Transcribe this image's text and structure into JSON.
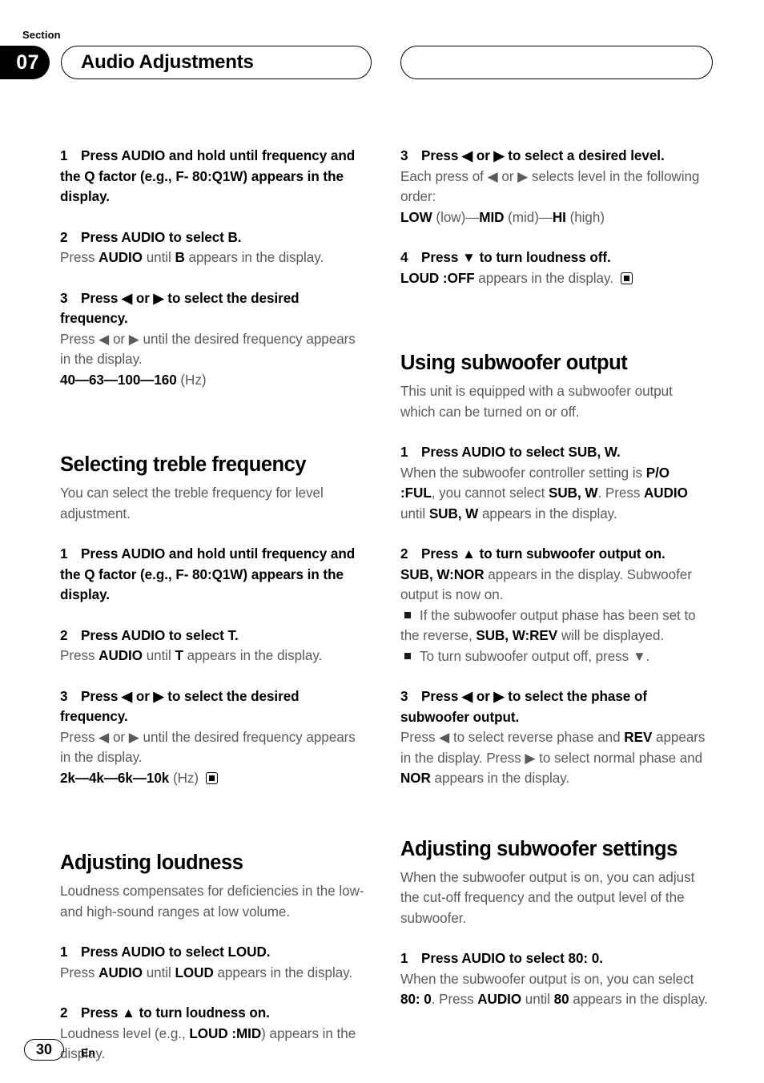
{
  "header": {
    "section_label": "Section",
    "section_number": "07",
    "title": "Audio Adjustments",
    "right_pill_title": ""
  },
  "footer": {
    "page_number": "30",
    "language": "En"
  },
  "left_column": {
    "bass_steps": [
      {
        "num": "1",
        "title_parts": [
          {
            "text": "Press AUDIO and hold until frequency and the Q factor (e.g., F- 80:Q1W) appears in the display.",
            "bold": true
          }
        ]
      },
      {
        "num": "2",
        "title_parts": [
          {
            "text": "Press AUDIO to select B.",
            "bold": true
          }
        ],
        "body_parts": [
          {
            "text": "Press ",
            "bold": false
          },
          {
            "text": "AUDIO",
            "bold": true
          },
          {
            "text": " until ",
            "bold": false
          },
          {
            "text": "B",
            "bold": true
          },
          {
            "text": " appears in the display.",
            "bold": false
          }
        ]
      },
      {
        "num": "3",
        "title_parts": [
          {
            "text": "Press ◀ or ▶ to select the desired frequency.",
            "bold": true
          }
        ],
        "body_parts": [
          {
            "text": "Press ◀ or ▶ until the desired frequency appears in the display.",
            "bold": false
          }
        ],
        "values_parts": [
          {
            "text": "40—63—100—160",
            "bold": true
          },
          {
            "text": " (Hz)",
            "bold": false
          }
        ]
      }
    ],
    "treble_heading": "Selecting treble frequency",
    "treble_lead": "You can select the treble frequency for level adjustment.",
    "treble_steps": [
      {
        "num": "1",
        "title_parts": [
          {
            "text": "Press AUDIO and hold until frequency and the Q factor (e.g., F- 80:Q1W) appears in the display.",
            "bold": true
          }
        ]
      },
      {
        "num": "2",
        "title_parts": [
          {
            "text": "Press AUDIO to select T.",
            "bold": true
          }
        ],
        "body_parts": [
          {
            "text": "Press ",
            "bold": false
          },
          {
            "text": "AUDIO",
            "bold": true
          },
          {
            "text": " until ",
            "bold": false
          },
          {
            "text": "T",
            "bold": true
          },
          {
            "text": " appears in the display.",
            "bold": false
          }
        ]
      },
      {
        "num": "3",
        "title_parts": [
          {
            "text": "Press ◀ or ▶ to select the desired frequency.",
            "bold": true
          }
        ],
        "body_parts": [
          {
            "text": "Press ◀ or ▶ until the desired frequency appears in the display.",
            "bold": false
          }
        ],
        "values_parts": [
          {
            "text": "2k—4k—6k—10k",
            "bold": true
          },
          {
            "text": " (Hz) ",
            "bold": false
          },
          {
            "text": "",
            "eos": true
          }
        ]
      }
    ],
    "loudness_heading": "Adjusting loudness",
    "loudness_lead": "Loudness compensates for deficiencies in the low- and high-sound ranges at low volume.",
    "loudness_steps": [
      {
        "num": "1",
        "title_parts": [
          {
            "text": "Press AUDIO to select LOUD.",
            "bold": true
          }
        ],
        "body_parts": [
          {
            "text": "Press ",
            "bold": false
          },
          {
            "text": "AUDIO",
            "bold": true
          },
          {
            "text": " until ",
            "bold": false
          },
          {
            "text": "LOUD",
            "bold": true
          },
          {
            "text": " appears in the display.",
            "bold": false
          }
        ]
      },
      {
        "num": "2",
        "title_parts": [
          {
            "text": "Press ▲ to turn loudness on.",
            "bold": true
          }
        ],
        "body_parts": [
          {
            "text": "Loudness level (e.g., ",
            "bold": false
          },
          {
            "text": "LOUD :MID",
            "bold": true
          },
          {
            "text": ") appears in the display.",
            "bold": false
          }
        ]
      }
    ]
  },
  "right_column": {
    "loudness_steps_cont": [
      {
        "num": "3",
        "title_parts": [
          {
            "text": "Press ◀ or ▶ to select a desired level.",
            "bold": true
          }
        ],
        "body_parts": [
          {
            "text": "Each press of ◀ or ▶ selects level in the following order:",
            "bold": false
          }
        ],
        "values_parts": [
          {
            "text": "LOW",
            "bold": true
          },
          {
            "text": " (low)—",
            "bold": false
          },
          {
            "text": "MID",
            "bold": true
          },
          {
            "text": " (mid)—",
            "bold": false
          },
          {
            "text": "HI",
            "bold": true
          },
          {
            "text": " (high)",
            "bold": false
          }
        ]
      },
      {
        "num": "4",
        "title_parts": [
          {
            "text": "Press ▼ to turn loudness off.",
            "bold": true
          }
        ],
        "body_parts": [
          {
            "text": "LOUD :OFF",
            "bold": true
          },
          {
            "text": " appears in the display. ",
            "bold": false
          },
          {
            "text": "",
            "eos": true
          }
        ]
      }
    ],
    "subwoofer_heading": "Using subwoofer output",
    "subwoofer_lead": "This unit is equipped with a subwoofer output which can be turned on or off.",
    "subwoofer_steps": [
      {
        "num": "1",
        "title_parts": [
          {
            "text": "Press AUDIO to select SUB, W.",
            "bold": true
          }
        ],
        "body_parts": [
          {
            "text": "When the subwoofer controller setting is ",
            "bold": false
          },
          {
            "text": "P/O :FUL",
            "bold": true
          },
          {
            "text": ", you cannot select ",
            "bold": false
          },
          {
            "text": "SUB, W",
            "bold": true
          },
          {
            "text": ". Press ",
            "bold": false
          },
          {
            "text": "AUDIO",
            "bold": true
          },
          {
            "text": " until ",
            "bold": false
          },
          {
            "text": "SUB, W",
            "bold": true
          },
          {
            "text": " appears in the display.",
            "bold": false
          }
        ]
      },
      {
        "num": "2",
        "title_parts": [
          {
            "text": "Press ▲ to turn subwoofer output on.",
            "bold": true
          }
        ],
        "body_parts": [
          {
            "text": "SUB, W:NOR",
            "bold": true
          },
          {
            "text": " appears in the display. Subwoofer output is now on.",
            "bold": false
          }
        ],
        "bullets": [
          [
            {
              "text": "If the subwoofer output phase has been set to the reverse, ",
              "bold": false
            },
            {
              "text": "SUB, W:REV",
              "bold": true
            },
            {
              "text": " will be displayed.",
              "bold": false
            }
          ],
          [
            {
              "text": "To turn subwoofer output off, press ▼.",
              "bold": false
            }
          ]
        ]
      },
      {
        "num": "3",
        "title_parts": [
          {
            "text": "Press ◀ or ▶ to select the phase of subwoofer output.",
            "bold": true
          }
        ],
        "body_parts": [
          {
            "text": "Press ◀ to select reverse phase and ",
            "bold": false
          },
          {
            "text": "REV",
            "bold": true
          },
          {
            "text": " appears in the display. Press ▶ to select normal phase and ",
            "bold": false
          },
          {
            "text": "NOR",
            "bold": true
          },
          {
            "text": " appears in the display.",
            "bold": false
          }
        ]
      }
    ],
    "sub_settings_heading": "Adjusting subwoofer settings",
    "sub_settings_lead": "When the subwoofer output is on, you can adjust the cut-off frequency and the output level of the subwoofer.",
    "sub_settings_steps": [
      {
        "num": "1",
        "title_parts": [
          {
            "text": "Press AUDIO to select 80: 0.",
            "bold": true
          }
        ],
        "body_parts": [
          {
            "text": "When the subwoofer output is on, you can select ",
            "bold": false
          },
          {
            "text": "80: 0",
            "bold": true
          },
          {
            "text": ". Press ",
            "bold": false
          },
          {
            "text": "AUDIO",
            "bold": true
          },
          {
            "text": " until ",
            "bold": false
          },
          {
            "text": "80",
            "bold": true
          },
          {
            "text": " appears in the display.",
            "bold": false
          }
        ]
      }
    ]
  }
}
